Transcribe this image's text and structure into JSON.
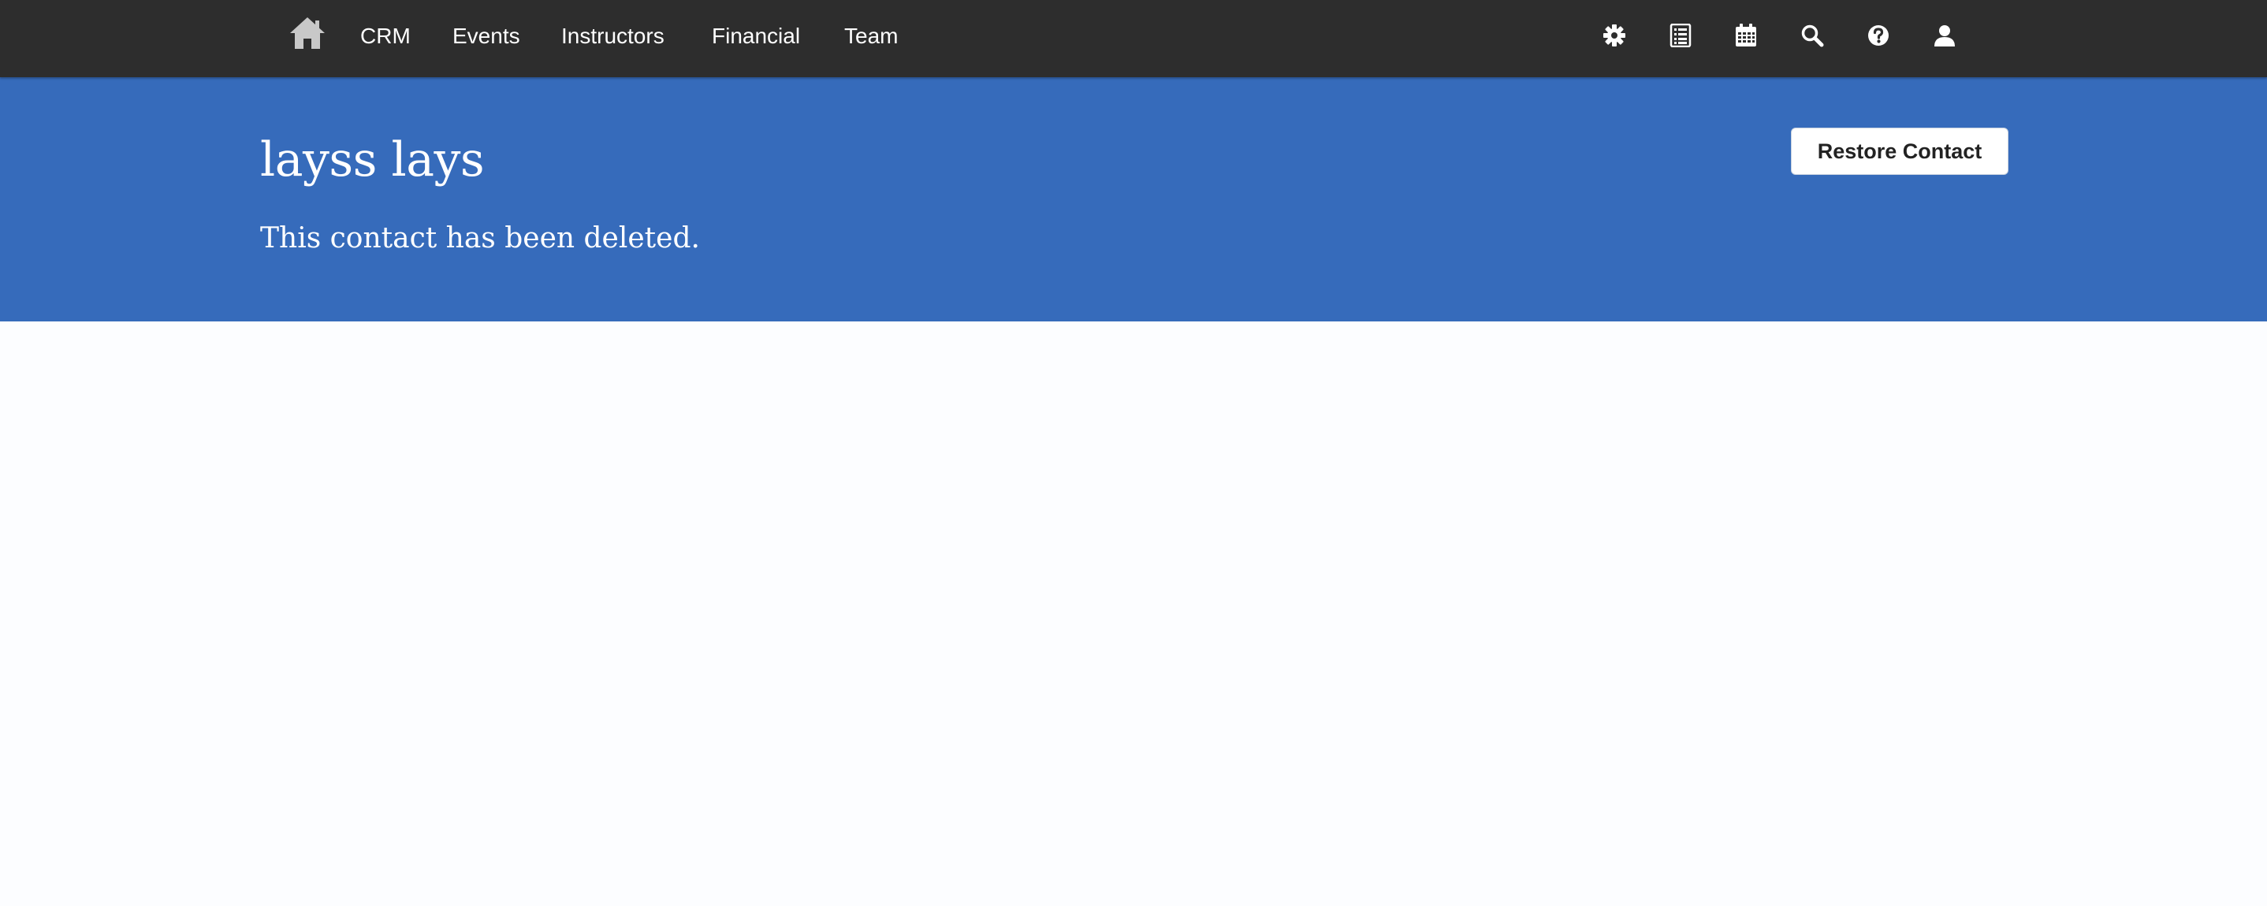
{
  "nav": {
    "items": [
      {
        "label": "CRM"
      },
      {
        "label": "Events"
      },
      {
        "label": "Instructors"
      },
      {
        "label": "Financial"
      },
      {
        "label": "Team"
      }
    ],
    "icons": [
      "home-icon",
      "gear-icon",
      "list-icon",
      "calendar-icon",
      "search-icon",
      "help-icon",
      "user-icon"
    ]
  },
  "contact": {
    "name": "layss lays",
    "status_message": "This contact has been deleted.",
    "restore_label": "Restore Contact"
  },
  "colors": {
    "topbar": "#2d2d2d",
    "banner": "#366bbb",
    "page_bg": "#fcfdff",
    "home_icon": "#c8c8c8",
    "toolbar_icon": "#ffffff"
  }
}
